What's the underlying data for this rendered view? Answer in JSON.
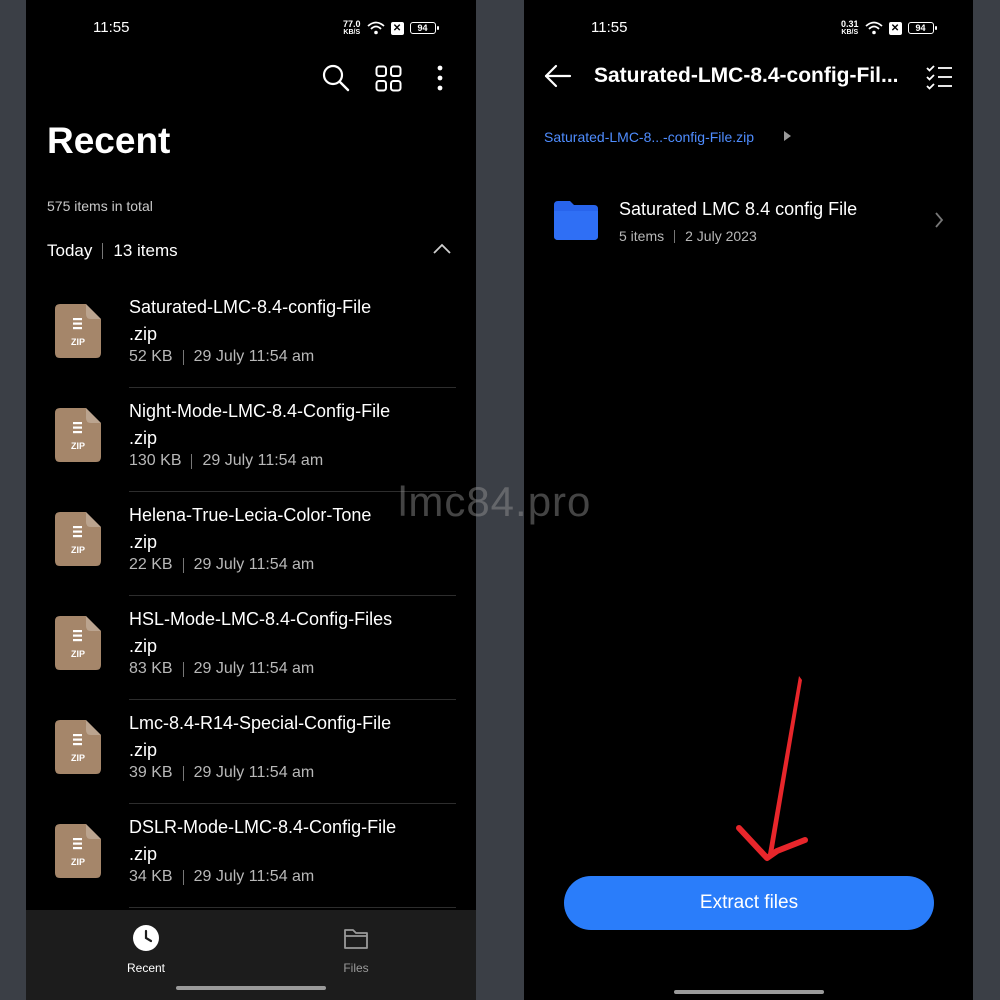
{
  "left": {
    "status": {
      "time": "11:55",
      "speed_value": "77.0",
      "speed_unit": "KB/S",
      "battery": "94"
    },
    "header": {
      "title": "Recent",
      "total": "575 items in total"
    },
    "group": {
      "label": "Today",
      "count": "13 items"
    },
    "files": [
      {
        "name_line1": "Saturated-LMC-8.4-config-File",
        "name_line2": ".zip",
        "size": "52 KB",
        "date": "29 July 11:54 am"
      },
      {
        "name_line1": "Night-Mode-LMC-8.4-Config-File",
        "name_line2": ".zip",
        "size": "130 KB",
        "date": "29 July 11:54 am"
      },
      {
        "name_line1": "Helena-True-Lecia-Color-Tone",
        "name_line2": ".zip",
        "size": "22 KB",
        "date": "29 July 11:54 am"
      },
      {
        "name_line1": "HSL-Mode-LMC-8.4-Config-Files",
        "name_line2": ".zip",
        "size": "83 KB",
        "date": "29 July 11:54 am"
      },
      {
        "name_line1": "Lmc-8.4-R14-Special-Config-File",
        "name_line2": ".zip",
        "size": "39 KB",
        "date": "29 July 11:54 am"
      },
      {
        "name_line1": "DSLR-Mode-LMC-8.4-Config-File",
        "name_line2": ".zip",
        "size": "34 KB",
        "date": "29 July 11:54 am"
      }
    ],
    "zip_icon_label": "ZIP",
    "nav": {
      "recent_label": "Recent",
      "files_label": "Files"
    }
  },
  "right": {
    "status": {
      "time": "11:55",
      "speed_value": "0.31",
      "speed_unit": "KB/S",
      "battery": "94"
    },
    "title": "Saturated-LMC-8.4-config-Fil...",
    "breadcrumb": "Saturated-LMC-8...-config-File.zip",
    "folder": {
      "name": "Saturated LMC 8.4 config File",
      "items": "5 items",
      "date": "2 July 2023"
    },
    "extract_label": "Extract files"
  },
  "watermark": "lmc84.pro",
  "colors": {
    "accent": "#2a7dfa",
    "zip_icon": "#a5866a",
    "folder": "#2864ec",
    "annotation_arrow": "#e8262b",
    "breadcrumb": "#4f8dff"
  }
}
